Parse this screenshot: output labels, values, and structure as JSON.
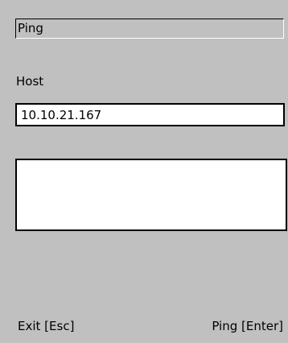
{
  "title_field": {
    "text": "Ping"
  },
  "host": {
    "label": "Host",
    "value": "10.10.21.167"
  },
  "output": {
    "text": ""
  },
  "softkeys": {
    "left_label": "Exit [Esc]",
    "right_label": "Ping [Enter]"
  },
  "colors": {
    "background": "#c0c0c0",
    "field_background": "#ffffff",
    "border": "#000000",
    "text": "#000000"
  }
}
